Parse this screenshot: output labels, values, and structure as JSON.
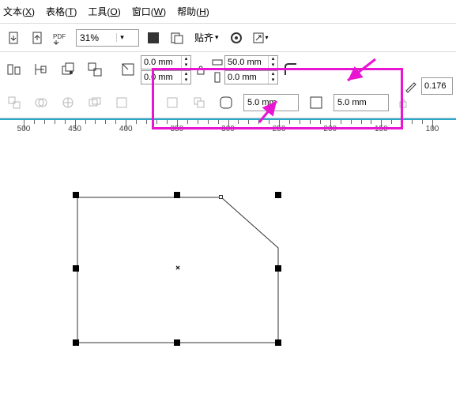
{
  "menu": {
    "text": {
      "label": "文本",
      "key": "X"
    },
    "table": {
      "label": "表格",
      "key": "T"
    },
    "tools": {
      "label": "工具",
      "key": "O"
    },
    "window": {
      "label": "窗口",
      "key": "W"
    },
    "help": {
      "label": "帮助",
      "key": "H"
    }
  },
  "toolbar": {
    "zoom": "31%",
    "snap": "贴齐"
  },
  "propbar": {
    "position": {
      "x": "0.0 mm",
      "y": "0.0 mm"
    },
    "size": {
      "width": "50.0 mm",
      "height": "0.0 mm"
    }
  },
  "corner": {
    "radius_a": "5.0 mm",
    "radius_b": "5.0 mm"
  },
  "outline": "0.176",
  "ruler": {
    "ticks": [
      500,
      450,
      400,
      350,
      300,
      250,
      200,
      150,
      100
    ]
  }
}
